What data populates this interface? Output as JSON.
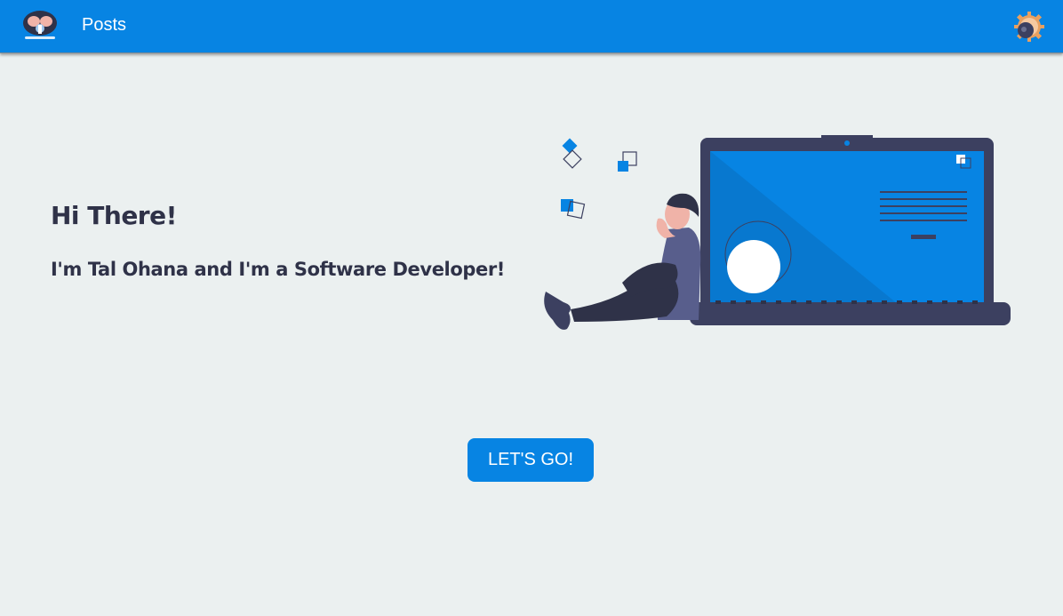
{
  "navbar": {
    "logo_icon": "astronaut-logo-icon",
    "posts_label": "Posts",
    "settings_icon": "gear-avatar-icon",
    "background_color": "#0784e3"
  },
  "hero": {
    "greeting": "Hi There!",
    "intro": "I'm Tal Ohana and I'm a Software Developer!",
    "illustration_icon": "developer-laptop-illustration"
  },
  "cta": {
    "label": "LET'S GO!"
  },
  "colors": {
    "accent": "#0784e3",
    "text": "#2f3248",
    "background": "#ebf0f0"
  }
}
